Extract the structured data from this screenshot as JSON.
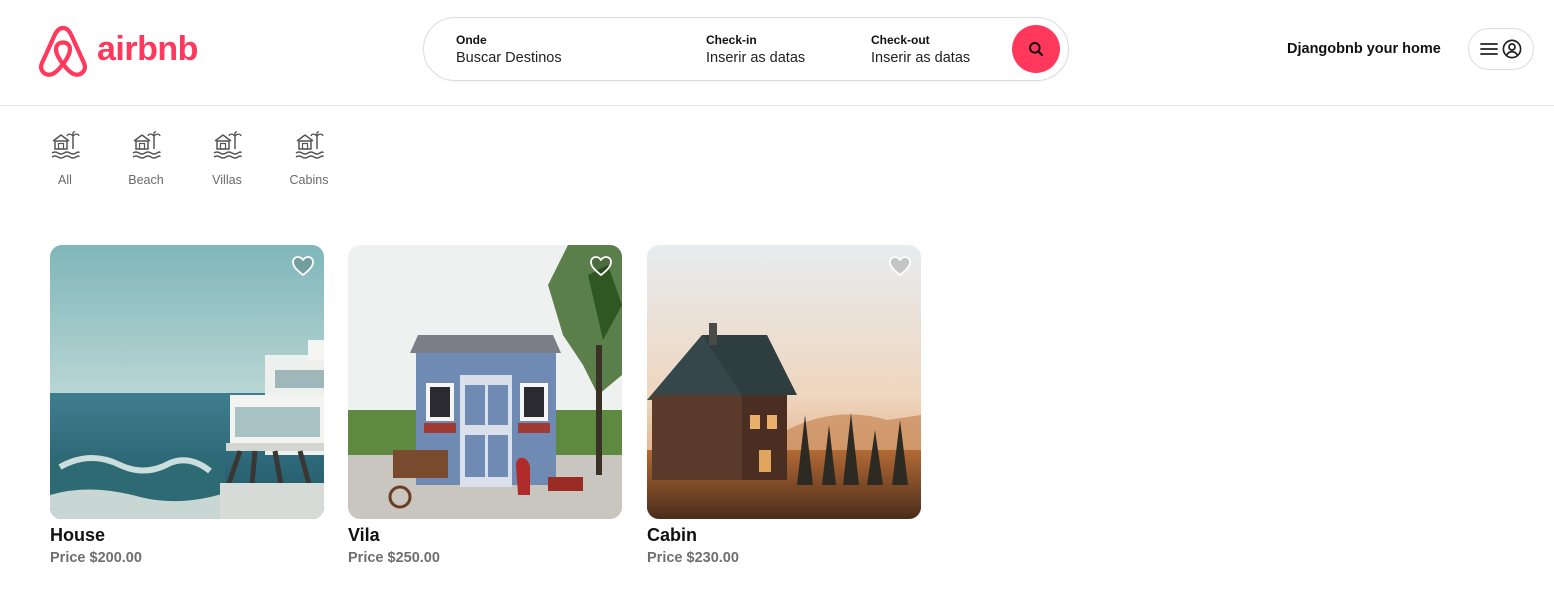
{
  "brand": {
    "name": "airbnb",
    "color": "#ff385c"
  },
  "search": {
    "where_label": "Onde",
    "where_value": "Buscar Destinos",
    "checkin_label": "Check-in",
    "checkin_value": "Inserir as datas",
    "checkout_label": "Check-out",
    "checkout_value": "Inserir as datas",
    "button_icon": "search-icon"
  },
  "header": {
    "host_link": "Djangobnb your home",
    "menu_icon": "hamburger-icon",
    "profile_icon": "user-circle-icon"
  },
  "categories": [
    {
      "label": "All",
      "icon": "beach-house-icon"
    },
    {
      "label": "Beach",
      "icon": "beach-house-icon"
    },
    {
      "label": "Villas",
      "icon": "beach-house-icon"
    },
    {
      "label": "Cabins",
      "icon": "beach-house-icon"
    }
  ],
  "listings": [
    {
      "title": "House",
      "price": "Price $200.00",
      "favorite_icon": "heart-icon"
    },
    {
      "title": "Vila",
      "price": "Price $250.00",
      "favorite_icon": "heart-icon"
    },
    {
      "title": "Cabin",
      "price": "Price $230.00",
      "favorite_icon": "heart-icon"
    }
  ]
}
